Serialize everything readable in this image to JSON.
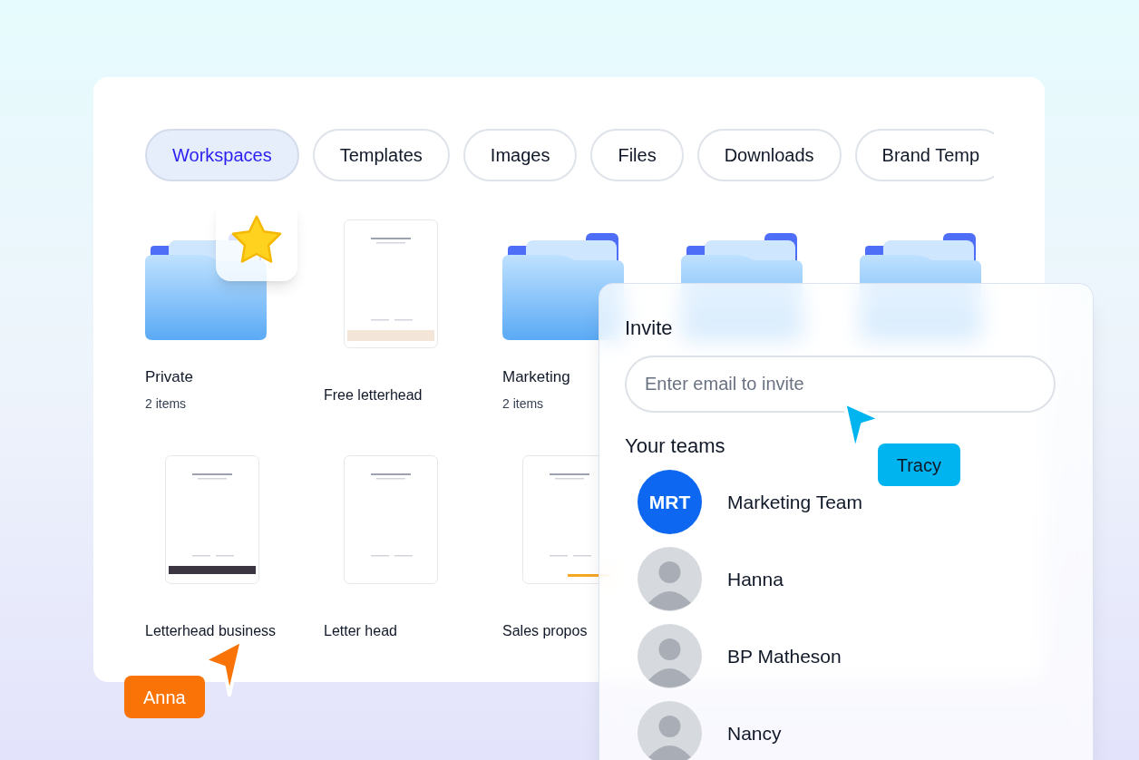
{
  "tabs": [
    {
      "label": "Workspaces",
      "selected": true
    },
    {
      "label": "Templates",
      "selected": false
    },
    {
      "label": "Images",
      "selected": false
    },
    {
      "label": "Files",
      "selected": false
    },
    {
      "label": "Downloads",
      "selected": false
    },
    {
      "label": "Brand Temp",
      "selected": false
    }
  ],
  "items": [
    {
      "kind": "folder",
      "name": "Private",
      "count": "2 items",
      "starred": true
    },
    {
      "kind": "letterhead_light",
      "name": "Free letterhead"
    },
    {
      "kind": "folder",
      "name": "Marketing",
      "count": "2 items",
      "starred": false
    },
    {
      "kind": "folder",
      "starred": false
    },
    {
      "kind": "folder",
      "starred": false
    },
    {
      "kind": "letterhead_dark",
      "name": "Letterhead business"
    },
    {
      "kind": "letterhead_plain",
      "name": "Letter head"
    },
    {
      "kind": "letterhead_accent",
      "name": "Sales propos"
    }
  ],
  "invite": {
    "title": "Invite",
    "placeholder": "Enter email to invite",
    "teams_title": "Your teams",
    "members": [
      {
        "kind": "initials",
        "initials": "MRT",
        "name": "Marketing Team"
      },
      {
        "kind": "photo",
        "name": "Hanna"
      },
      {
        "kind": "photo",
        "name": "BP Matheson"
      },
      {
        "kind": "photo",
        "name": "Nancy"
      }
    ]
  },
  "cursors": [
    {
      "label": "Tracy",
      "color": "#00b4f0"
    },
    {
      "label": "Anna",
      "color": "#f97306"
    }
  ]
}
